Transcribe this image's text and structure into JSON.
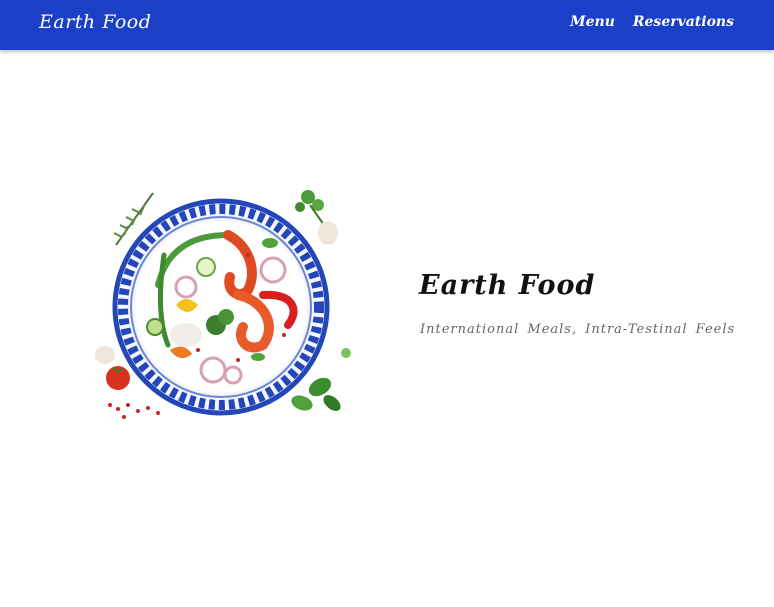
{
  "navbar": {
    "brand": "Earth Food",
    "links": [
      {
        "label": "Menu"
      },
      {
        "label": "Reservations"
      }
    ],
    "background": "#1b3fc6"
  },
  "hero": {
    "title": "Earth Food",
    "tagline": "International Meals, Intra-Testinal Feels",
    "image": "seafood-plate-illustration"
  }
}
